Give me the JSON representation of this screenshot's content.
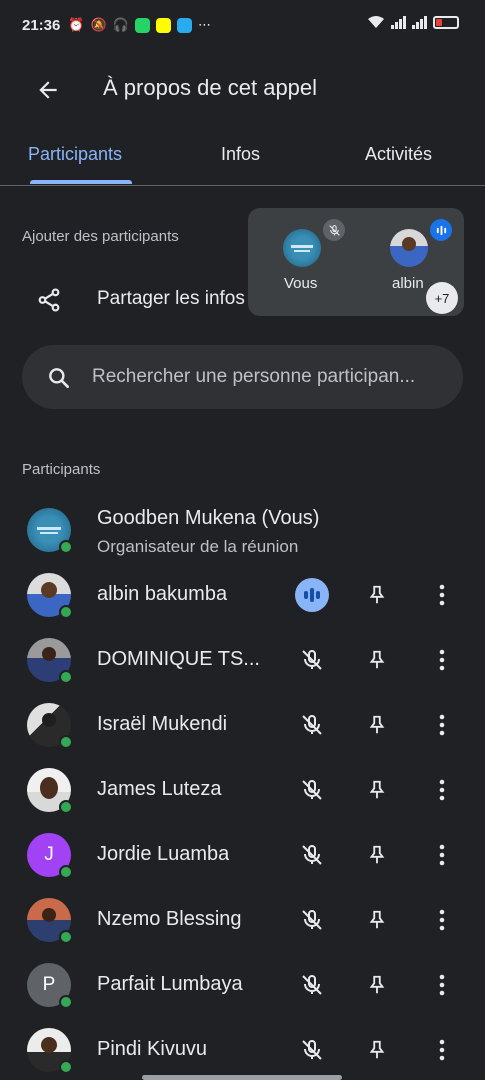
{
  "status_bar": {
    "time": "21:36",
    "battery_level": 0.25
  },
  "app_bar": {
    "title": "À propos de cet appel"
  },
  "tabs": [
    {
      "label": "Participants",
      "active": true
    },
    {
      "label": "Infos",
      "active": false
    },
    {
      "label": "Activités",
      "active": false
    }
  ],
  "add_section": {
    "label": "Ajouter des participants",
    "share_label": "Partager les infos"
  },
  "floating_card": {
    "tiles": [
      {
        "name": "Vous",
        "muted": true
      },
      {
        "name": "albin",
        "speaking": true
      }
    ],
    "more_count": "+7"
  },
  "search": {
    "placeholder": "Rechercher une personne participan..."
  },
  "participants_section": {
    "label": "Participants",
    "rows": [
      {
        "name": "Goodben Mukena (Vous)",
        "subtitle": "Organisateur de la réunion",
        "avatar": "logo",
        "state": "self"
      },
      {
        "name": "albin bakumba",
        "avatar": "photo",
        "state": "speaking"
      },
      {
        "name": "DOMINIQUE TS...",
        "avatar": "photo",
        "state": "muted"
      },
      {
        "name": "Israël Mukendi",
        "avatar": "photo",
        "state": "muted"
      },
      {
        "name": "James Luteza",
        "avatar": "photo",
        "state": "muted"
      },
      {
        "name": "Jordie Luamba",
        "avatar": "J",
        "state": "muted"
      },
      {
        "name": "Nzemo Blessing",
        "avatar": "photo",
        "state": "muted"
      },
      {
        "name": "Parfait Lumbaya",
        "avatar": "P",
        "state": "muted"
      },
      {
        "name": "Pindi Kivuvu",
        "avatar": "photo",
        "state": "muted"
      }
    ]
  },
  "colors": {
    "background": "#202124",
    "accent": "#8ab4f8",
    "presence": "#34a853",
    "avatar_j": "#a142f4",
    "avatar_p": "#5f6368"
  }
}
